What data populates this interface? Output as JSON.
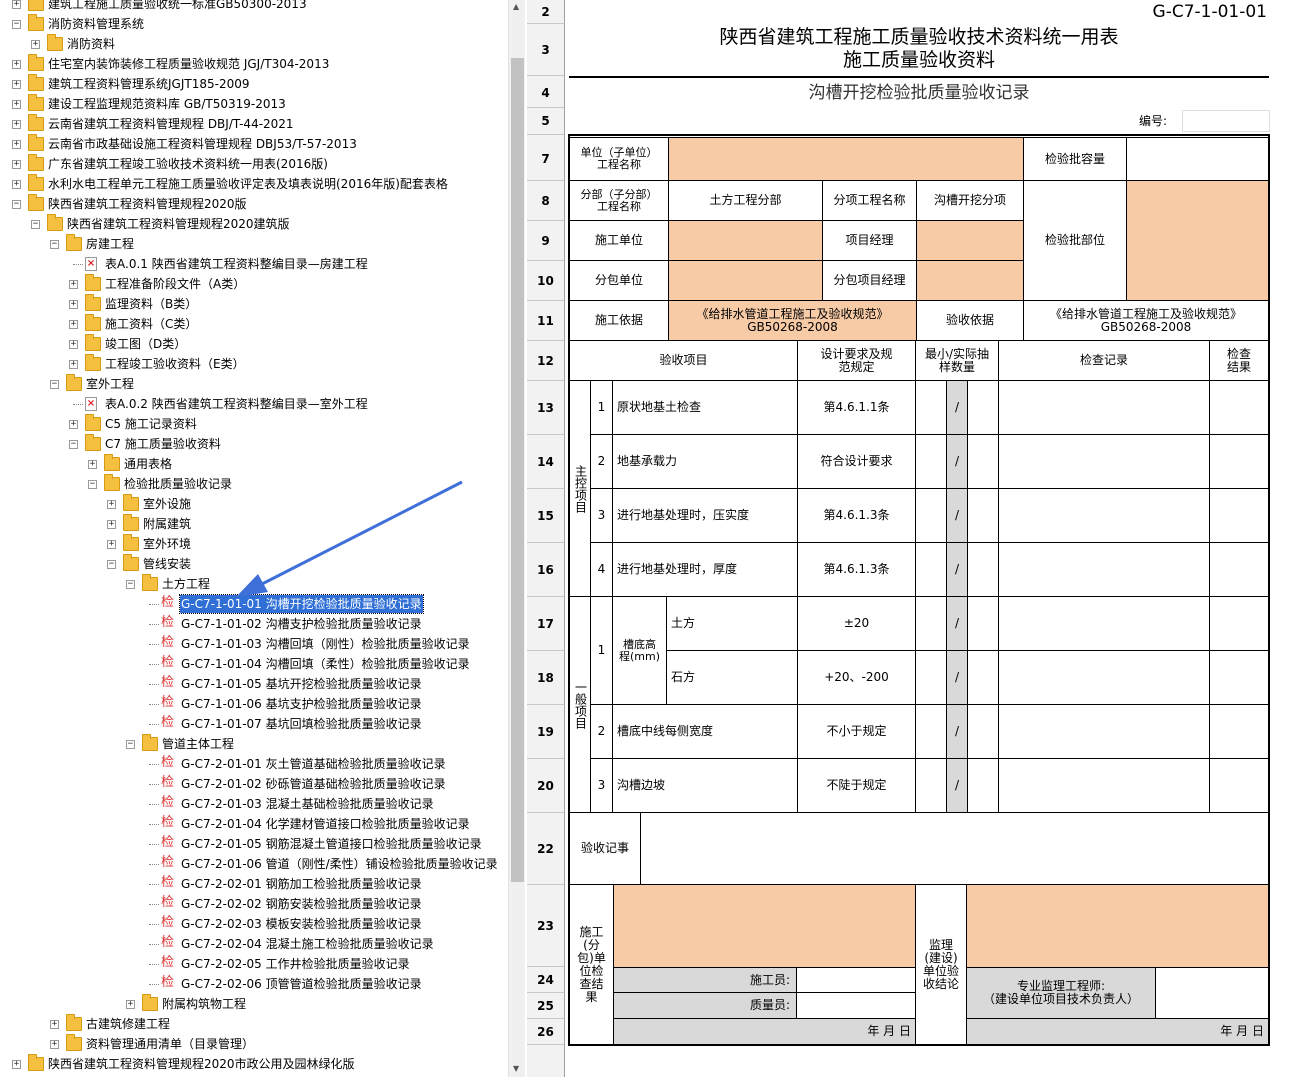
{
  "tree": {
    "nodes": [
      {
        "label": "建筑工程施工质量验收统一标准GB50300-2013",
        "level": 1,
        "expander": "+",
        "icon": "folder"
      },
      {
        "label": "消防资料管理系统",
        "level": 1,
        "expander": "-",
        "icon": "folder"
      },
      {
        "label": "消防资料",
        "level": 2,
        "expander": "+",
        "icon": "folder"
      },
      {
        "label": "住宅室内装饰装修工程质量验收规范 JGJ/T304-2013",
        "level": 1,
        "expander": "+",
        "icon": "folder"
      },
      {
        "label": "建筑工程资料管理系统JGJT185-2009",
        "level": 1,
        "expander": "+",
        "icon": "folder"
      },
      {
        "label": "建设工程监理规范资料库 GB/T50319-2013",
        "level": 1,
        "expander": "+",
        "icon": "folder"
      },
      {
        "label": "云南省建筑工程资料管理规程 DBJ/T-44-2021",
        "level": 1,
        "expander": "+",
        "icon": "folder"
      },
      {
        "label": "云南省市政基础设施工程资料管理规程 DBJ53/T-57-2013",
        "level": 1,
        "expander": "+",
        "icon": "folder"
      },
      {
        "label": "广东省建筑工程竣工验收技术资料统一用表(2016版)",
        "level": 1,
        "expander": "+",
        "icon": "folder"
      },
      {
        "label": "水利水电工程单元工程施工质量验收评定表及填表说明(2016年版)配套表格",
        "level": 1,
        "expander": "+",
        "icon": "folder"
      },
      {
        "label": "陕西省建筑工程资料管理规程2020版",
        "level": 1,
        "expander": "-",
        "icon": "folder"
      },
      {
        "label": "陕西省建筑工程资料管理规程2020建筑版",
        "level": 2,
        "expander": "-",
        "icon": "folder"
      },
      {
        "label": "房建工程",
        "level": 3,
        "expander": "-",
        "icon": "folder"
      },
      {
        "label": "表A.0.1 陕西省建筑工程资料整编目录—房建工程",
        "level": 4,
        "expander": "",
        "icon": "xdoc"
      },
      {
        "label": "工程准备阶段文件（A类）",
        "level": 4,
        "expander": "+",
        "icon": "folder"
      },
      {
        "label": "监理资料（B类）",
        "level": 4,
        "expander": "+",
        "icon": "folder"
      },
      {
        "label": "施工资料（C类）",
        "level": 4,
        "expander": "+",
        "icon": "folder"
      },
      {
        "label": "竣工图（D类）",
        "level": 4,
        "expander": "+",
        "icon": "folder"
      },
      {
        "label": "工程竣工验收资料（E类）",
        "level": 4,
        "expander": "+",
        "icon": "folder"
      },
      {
        "label": "室外工程",
        "level": 3,
        "expander": "-",
        "icon": "folder"
      },
      {
        "label": "表A.0.2 陕西省建筑工程资料整编目录—室外工程",
        "level": 4,
        "expander": "",
        "icon": "xdoc"
      },
      {
        "label": "C5 施工记录资料",
        "level": 4,
        "expander": "+",
        "icon": "folder"
      },
      {
        "label": "C7 施工质量验收资料",
        "level": 4,
        "expander": "-",
        "icon": "folder"
      },
      {
        "label": "通用表格",
        "level": 5,
        "expander": "+",
        "icon": "folder"
      },
      {
        "label": "检验批质量验收记录",
        "level": 5,
        "expander": "-",
        "icon": "folder"
      },
      {
        "label": "室外设施",
        "level": 6,
        "expander": "+",
        "icon": "folder"
      },
      {
        "label": "附属建筑",
        "level": 6,
        "expander": "+",
        "icon": "folder"
      },
      {
        "label": "室外环境",
        "level": 6,
        "expander": "+",
        "icon": "folder"
      },
      {
        "label": "管线安装",
        "level": 6,
        "expander": "-",
        "icon": "folder"
      },
      {
        "label": "土方工程",
        "level": 7,
        "expander": "-",
        "icon": "folder"
      },
      {
        "label": "G-C7-1-01-01 沟槽开挖检验批质量验收记录",
        "level": 8,
        "expander": "",
        "icon": "jian",
        "selected": true
      },
      {
        "label": "G-C7-1-01-02 沟槽支护检验批质量验收记录",
        "level": 8,
        "expander": "",
        "icon": "jian"
      },
      {
        "label": "G-C7-1-01-03 沟槽回填（刚性）检验批质量验收记录",
        "level": 8,
        "expander": "",
        "icon": "jian"
      },
      {
        "label": "G-C7-1-01-04 沟槽回填（柔性）检验批质量验收记录",
        "level": 8,
        "expander": "",
        "icon": "jian"
      },
      {
        "label": "G-C7-1-01-05 基坑开挖检验批质量验收记录",
        "level": 8,
        "expander": "",
        "icon": "jian"
      },
      {
        "label": "G-C7-1-01-06 基坑支护检验批质量验收记录",
        "level": 8,
        "expander": "",
        "icon": "jian"
      },
      {
        "label": "G-C7-1-01-07 基坑回填检验批质量验收记录",
        "level": 8,
        "expander": "",
        "icon": "jian"
      },
      {
        "label": "管道主体工程",
        "level": 7,
        "expander": "-",
        "icon": "folder"
      },
      {
        "label": "G-C7-2-01-01 灰土管道基础检验批质量验收记录",
        "level": 8,
        "expander": "",
        "icon": "jian"
      },
      {
        "label": "G-C7-2-01-02 砂砾管道基础检验批质量验收记录",
        "level": 8,
        "expander": "",
        "icon": "jian"
      },
      {
        "label": "G-C7-2-01-03 混凝土基础检验批质量验收记录",
        "level": 8,
        "expander": "",
        "icon": "jian"
      },
      {
        "label": "G-C7-2-01-04 化学建材管道接口检验批质量验收记录",
        "level": 8,
        "expander": "",
        "icon": "jian"
      },
      {
        "label": "G-C7-2-01-05 钢筋混凝土管道接口检验批质量验收记录",
        "level": 8,
        "expander": "",
        "icon": "jian"
      },
      {
        "label": "G-C7-2-01-06 管道（刚性/柔性）铺设检验批质量验收记录",
        "level": 8,
        "expander": "",
        "icon": "jian"
      },
      {
        "label": "G-C7-2-02-01 钢筋加工检验批质量验收记录",
        "level": 8,
        "expander": "",
        "icon": "jian"
      },
      {
        "label": "G-C7-2-02-02 钢筋安装检验批质量验收记录",
        "level": 8,
        "expander": "",
        "icon": "jian"
      },
      {
        "label": "G-C7-2-02-03 模板安装检验批质量验收记录",
        "level": 8,
        "expander": "",
        "icon": "jian"
      },
      {
        "label": "G-C7-2-02-04 混凝土施工检验批质量验收记录",
        "level": 8,
        "expander": "",
        "icon": "jian"
      },
      {
        "label": "G-C7-2-02-05 工作井检验批质量验收记录",
        "level": 8,
        "expander": "",
        "icon": "jian"
      },
      {
        "label": "G-C7-2-02-06 顶管管道检验批质量验收记录",
        "level": 8,
        "expander": "",
        "icon": "jian"
      },
      {
        "label": "附属构筑物工程",
        "level": 7,
        "expander": "+",
        "icon": "folder"
      },
      {
        "label": "古建筑修建工程",
        "level": 3,
        "expander": "+",
        "icon": "folder"
      },
      {
        "label": "资料管理通用清单（目录管理）",
        "level": 3,
        "expander": "+",
        "icon": "folder"
      },
      {
        "label": "陕西省建筑工程资料管理规程2020市政公用及园林绿化版",
        "level": 1,
        "expander": "+",
        "icon": "folder"
      }
    ],
    "file_icon_glyph": "检"
  },
  "sheet": {
    "row_numbers": [
      "2",
      "3",
      "4",
      "5",
      "7",
      "8",
      "9",
      "10",
      "11",
      "12",
      "13",
      "14",
      "15",
      "16",
      "17",
      "18",
      "19",
      "20",
      "22",
      "23",
      "24",
      "25",
      "26"
    ],
    "form_code": "G-C7-1-01-01",
    "title_line1": "陕西省建筑工程施工质量验收技术资料统一用表",
    "title_line2": "施工质量验收资料",
    "subtitle": "沟槽开挖检验批质量验收记录",
    "number_label": "编号:",
    "labels": {
      "unit_project": "单位（子单位）工程名称",
      "batch_capacity": "检验批容量",
      "sub_project": "分部（子分部）工程名称",
      "sub_project_value": "土方工程分部",
      "item_project": "分项工程名称",
      "item_project_value": "沟槽开挖分项",
      "batch_position": "检验批部位",
      "construction_unit": "施工单位",
      "project_manager": "项目经理",
      "subcontract_unit": "分包单位",
      "subcontract_manager": "分包项目经理",
      "construction_basis": "施工依据",
      "construction_basis_value_1": "《给排水管道工程施工及验收规范》",
      "construction_basis_value_2": "GB50268-2008",
      "acceptance_basis": "验收依据",
      "acceptance_basis_value_1": "《给排水管道工程施工及验收规范》",
      "acceptance_basis_value_2": "GB50268-2008",
      "col_item": "验收项目",
      "col_design": "设计要求及规范规定",
      "col_sample": "最小/实际抽样数量",
      "col_record": "检查记录",
      "col_result": "检查结果",
      "main_control": "主控项目",
      "general": "一般项目",
      "groove_bottom": "槽底高程(mm)",
      "acceptance_notes": "验收记事",
      "construction_check": "施工(分包)单位检查结果",
      "builder": "施工员:",
      "quality_officer": "质量员:",
      "date": "年   月   日",
      "supervision_conclusion": "监理(建设)单位验收结论",
      "supervisor": "专业监理工程师:",
      "supervisor_note": "（建设单位项目技术负责人）",
      "date2": "年   月   日"
    },
    "main_items": [
      {
        "no": "1",
        "name": "原状地基土检查",
        "design": "第4.6.1.1条",
        "slash": "/"
      },
      {
        "no": "2",
        "name": "地基承载力",
        "design": "符合设计要求",
        "slash": "/"
      },
      {
        "no": "3",
        "name": "进行地基处理时，压实度",
        "design": "第4.6.1.3条",
        "slash": "/"
      },
      {
        "no": "4",
        "name": "进行地基处理时，厚度",
        "design": "第4.6.1.3条",
        "slash": "/"
      }
    ],
    "general_items": [
      {
        "no": "1",
        "name": "土方",
        "design": "±20",
        "slash": "/"
      },
      {
        "no": "",
        "name": "石方",
        "design": "+20、-200",
        "slash": "/"
      },
      {
        "no": "2",
        "name": "槽底中线每侧宽度",
        "design": "不小于规定",
        "slash": "/"
      },
      {
        "no": "3",
        "name": "沟槽边坡",
        "design": "不陡于规定",
        "slash": "/"
      }
    ],
    "colors": {
      "peach": "#f8cba7",
      "grey": "#d9d9d9",
      "selection": "#2f6fd6",
      "arrow": "#3f6fd8"
    }
  }
}
